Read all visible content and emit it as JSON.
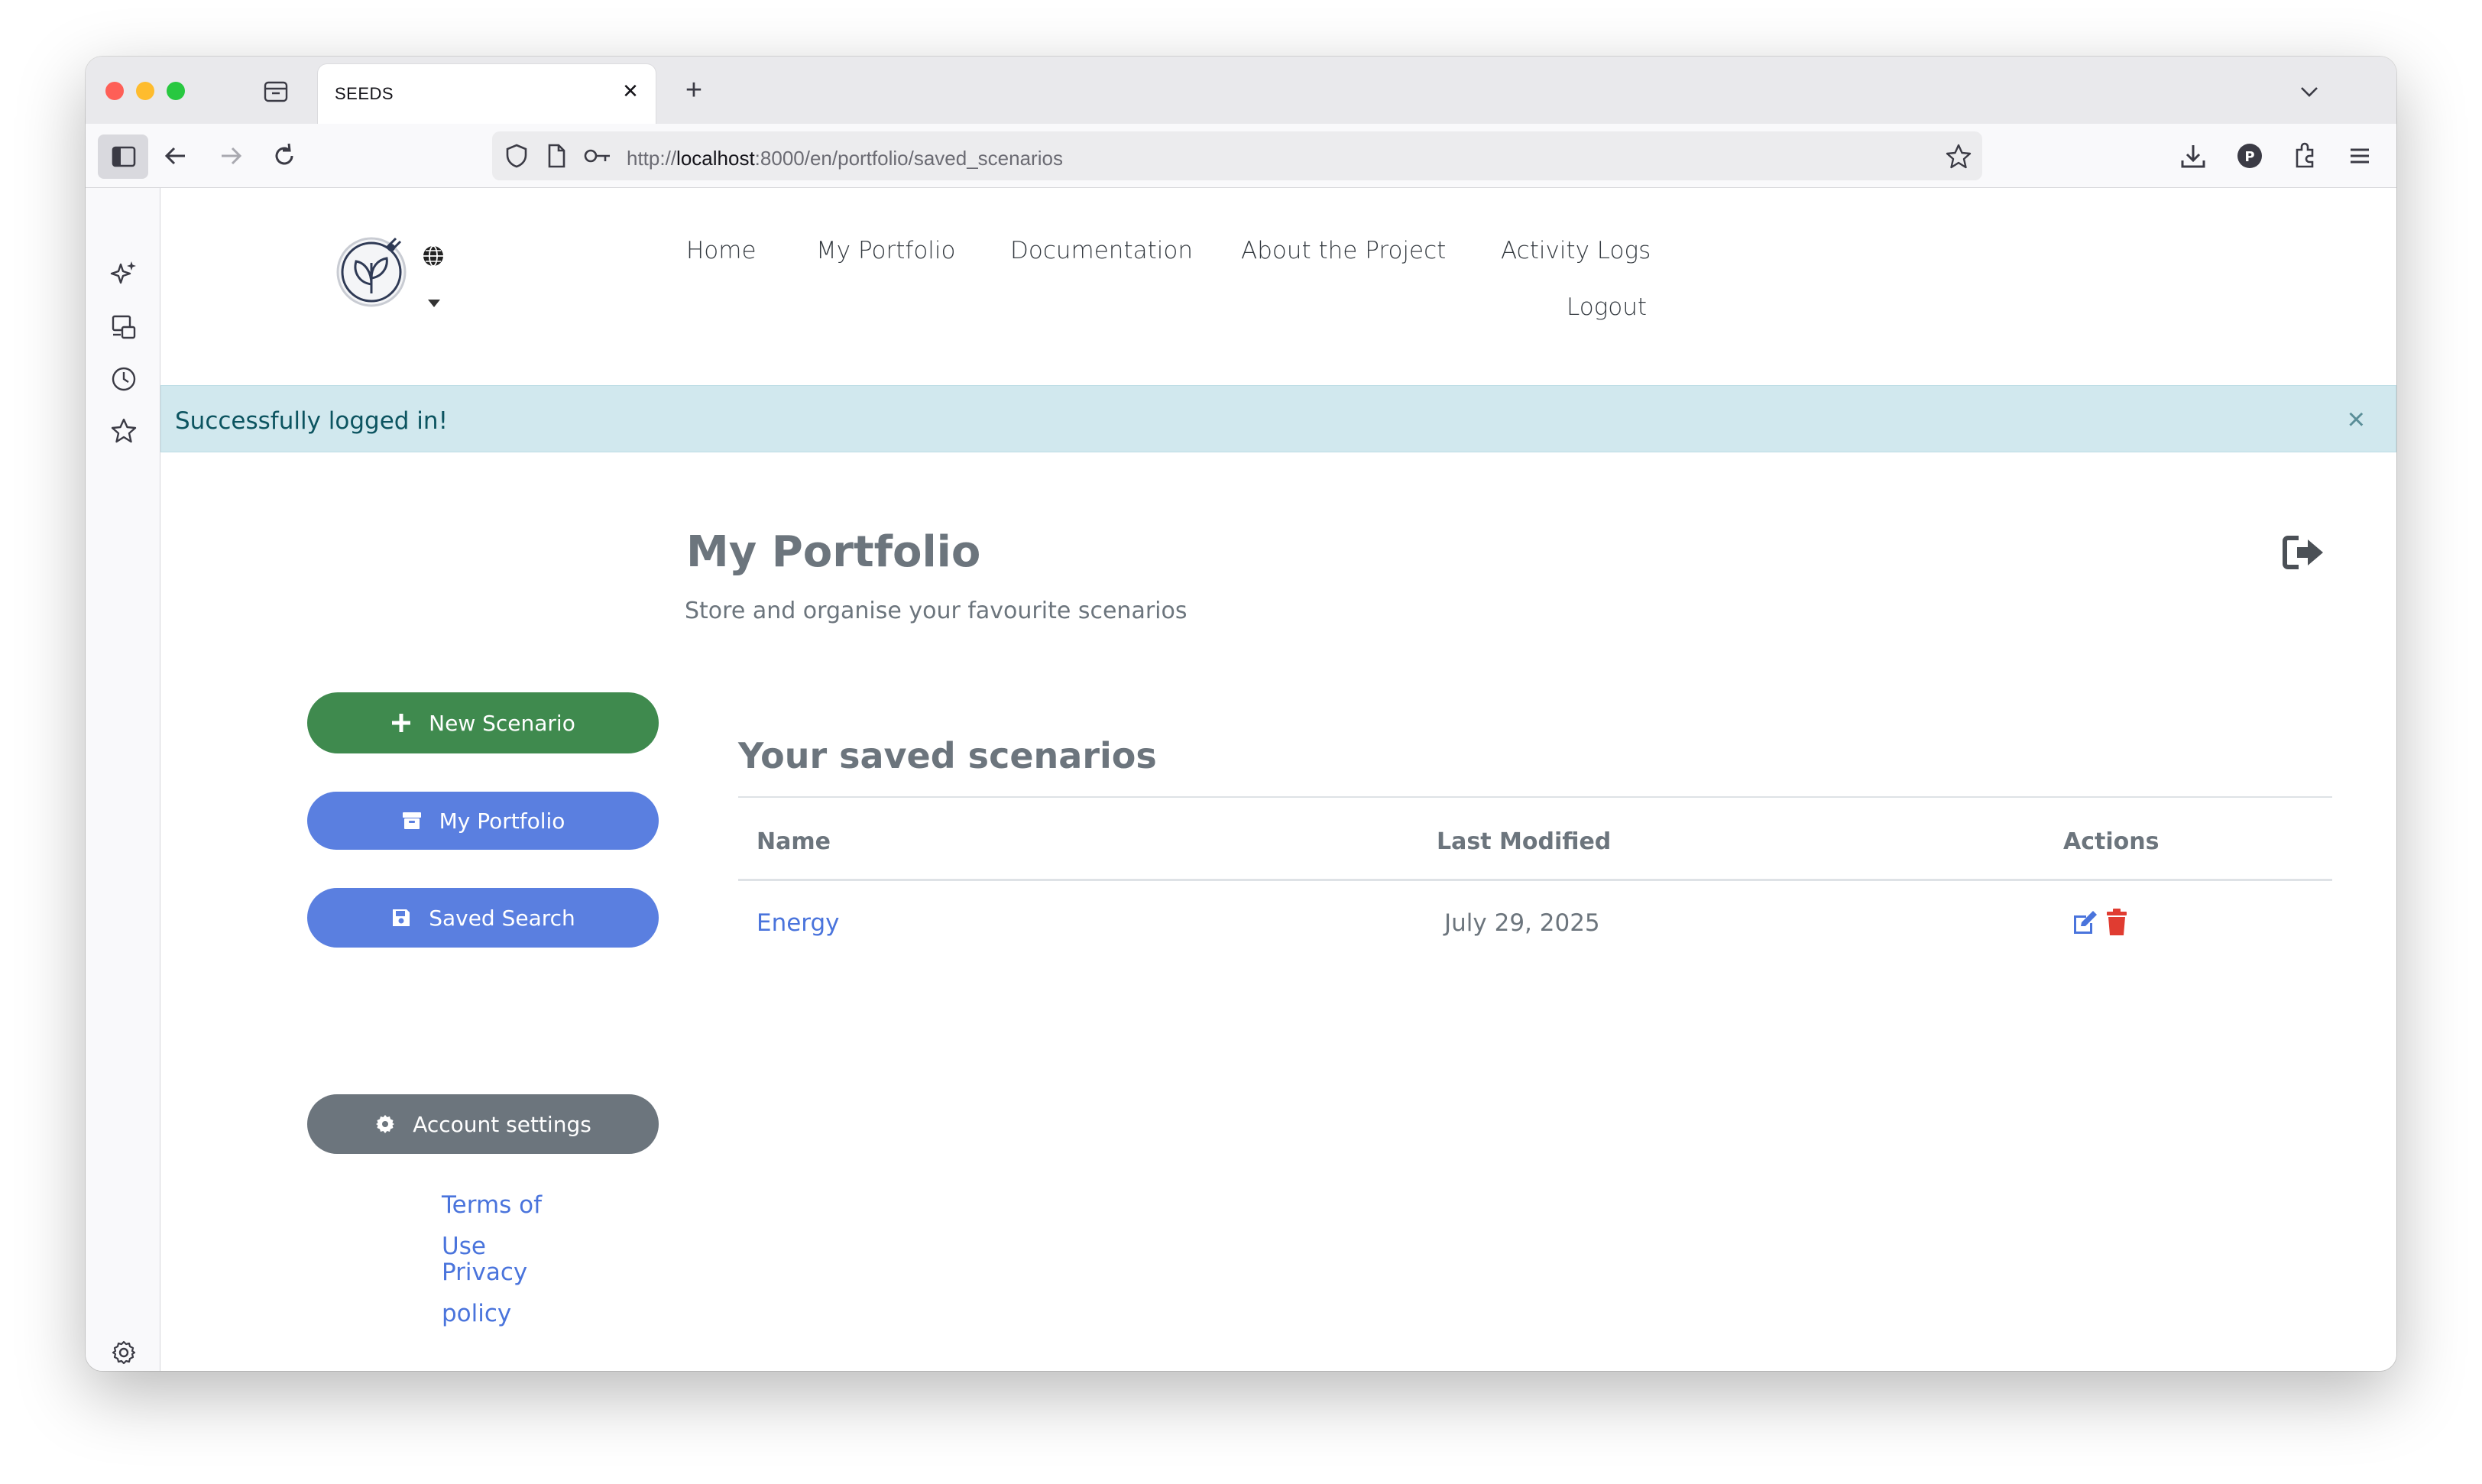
{
  "browser": {
    "tab_title": "SEEDS",
    "url_prefix": "http://",
    "url_host": "localhost",
    "url_rest": ":8000/en/portfolio/saved_scenarios"
  },
  "nav": {
    "home": "Home",
    "portfolio": "My Portfolio",
    "documentation": "Documentation",
    "about": "About the Project",
    "activity": "Activity Logs",
    "logout": "Logout"
  },
  "alert": {
    "message": "Successfully logged in!",
    "close": "×"
  },
  "sidebar_buttons": {
    "new_scenario": "New Scenario",
    "my_portfolio": "My Portfolio",
    "saved_search": "Saved Search",
    "account_settings": "Account settings"
  },
  "header": {
    "title": "My Portfolio",
    "subtitle": "Store and organise your favourite scenarios"
  },
  "scenarios": {
    "title": "Your saved scenarios",
    "columns": [
      "Name",
      "Last Modified",
      "Actions"
    ],
    "rows": [
      {
        "name": "Energy",
        "modified": "July 29, 2025"
      }
    ]
  },
  "footer": {
    "terms_1": "Terms of",
    "terms_2": "Use",
    "privacy_1": "Privacy",
    "privacy_2": "policy"
  },
  "colors": {
    "green": "#3f8a4e",
    "blue": "#5a7fe0",
    "gray": "#6c757d",
    "link": "#4a74dc",
    "delete_red": "#e03c31"
  },
  "icons": {
    "new_scenario": "plus-icon",
    "my_portfolio": "archive-icon",
    "saved_search": "floppy-disk-icon",
    "account_settings": "gear-icon",
    "edit": "edit-icon",
    "delete": "trash-icon",
    "exit": "sign-out-icon"
  }
}
